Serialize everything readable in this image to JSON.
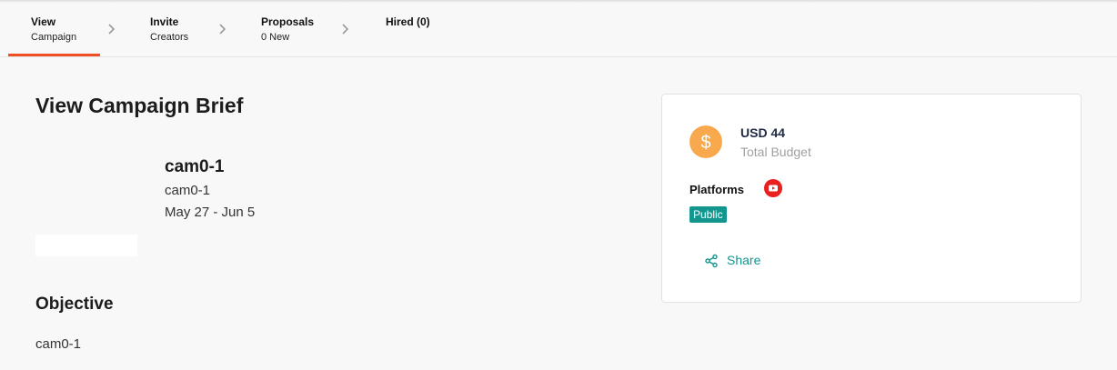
{
  "steps": [
    {
      "title": "View",
      "sub": "Campaign"
    },
    {
      "title": "Invite",
      "sub": "Creators"
    },
    {
      "title": "Proposals",
      "sub": "0 New"
    },
    {
      "title": "Hired (0)",
      "sub": ""
    }
  ],
  "page": {
    "title": "View Campaign Brief",
    "campaign_name": "cam0-1",
    "campaign_subtitle": "cam0-1",
    "dates": "May 27 - Jun 5",
    "objective_heading": "Objective",
    "objective_text": "cam0-1"
  },
  "sidebar_card": {
    "budget_amount": "USD 44",
    "budget_label": "Total Budget",
    "platforms_label": "Platforms",
    "platform_icon": "youtube-icon",
    "visibility_badge": "Public",
    "share_label": "Share"
  },
  "colors": {
    "accent": "#ef4f24",
    "teal": "#13968e",
    "coin": "#f8a84d",
    "youtube": "#e8201e"
  }
}
